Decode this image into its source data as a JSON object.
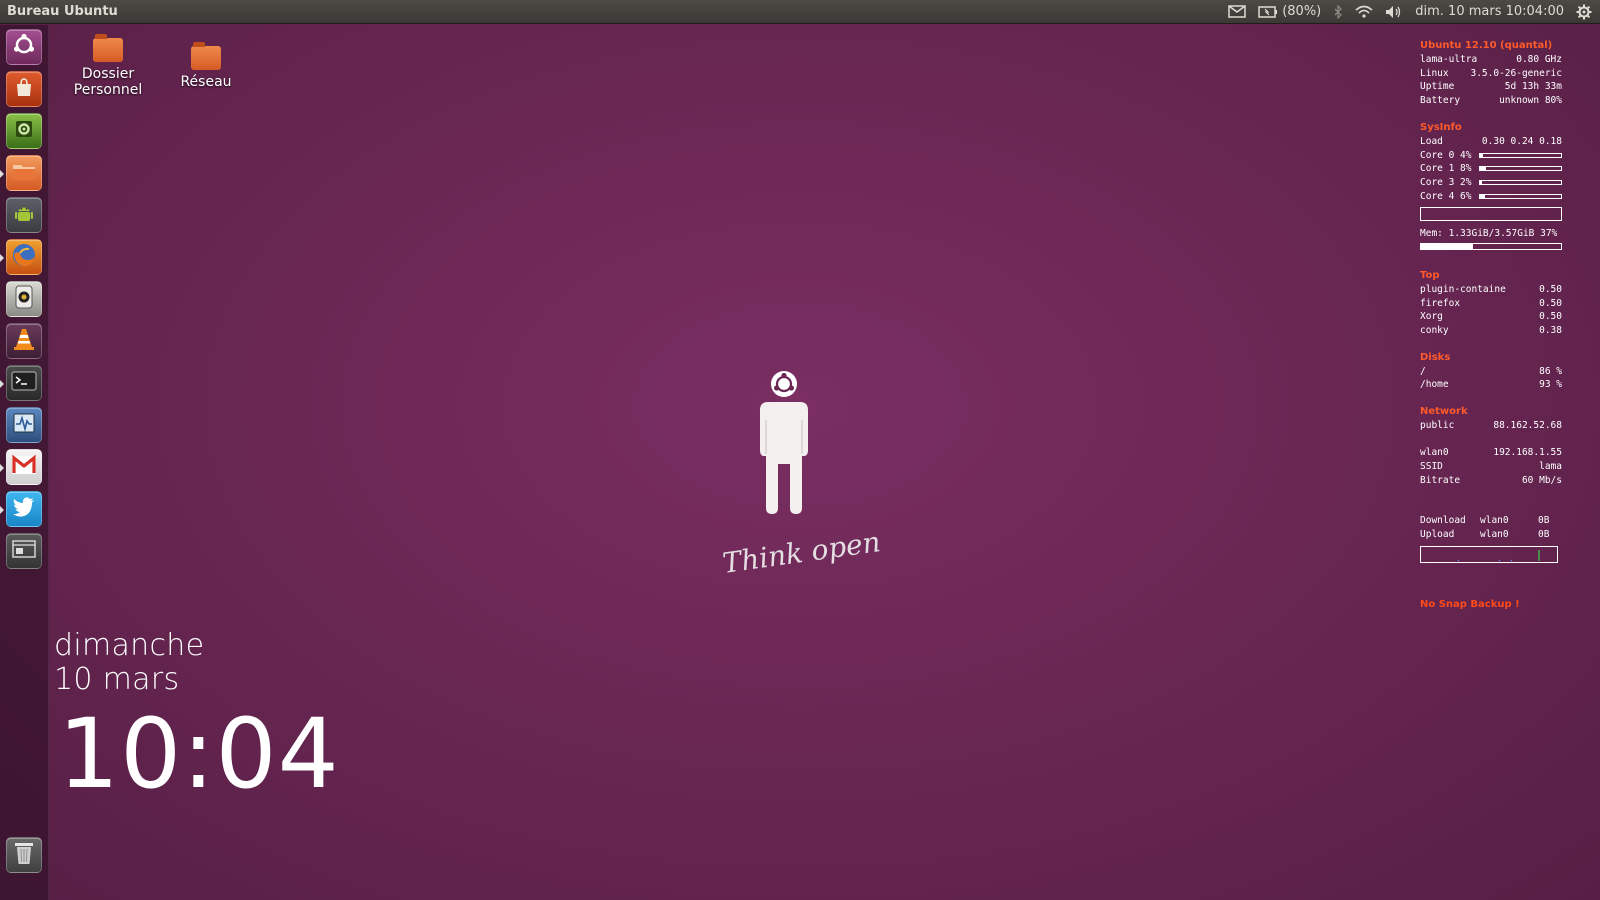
{
  "top_panel": {
    "title": "Bureau Ubuntu",
    "battery_text": "(80%)",
    "datetime": "dim. 10 mars  10:04:00",
    "icons": [
      "mail-icon",
      "battery-icon",
      "bluetooth-icon",
      "wifi-icon",
      "volume-icon",
      "gear-icon"
    ]
  },
  "launcher": {
    "items": [
      {
        "name": "dash-home",
        "icon": "ubuntu-logo-icon",
        "running": false
      },
      {
        "name": "software-center",
        "icon": "shopping-bag-icon",
        "running": false
      },
      {
        "name": "system-settings",
        "icon": "settings-icon",
        "running": false
      },
      {
        "name": "files",
        "icon": "folder-icon",
        "running": true
      },
      {
        "name": "android-sdk",
        "icon": "android-icon",
        "running": false
      },
      {
        "name": "firefox",
        "icon": "firefox-icon",
        "running": true
      },
      {
        "name": "rhythmbox",
        "icon": "speaker-icon",
        "running": false
      },
      {
        "name": "vlc",
        "icon": "vlc-cone-icon",
        "running": false
      },
      {
        "name": "terminal",
        "icon": "terminal-icon",
        "running": true
      },
      {
        "name": "system-monitor",
        "icon": "monitor-icon",
        "running": false
      },
      {
        "name": "gmail",
        "icon": "gmail-icon",
        "running": true
      },
      {
        "name": "twitter",
        "icon": "twitter-icon",
        "running": true
      },
      {
        "name": "workspace-switcher",
        "icon": "workspace-icon",
        "running": false
      },
      {
        "name": "trash",
        "icon": "trash-icon",
        "running": false
      }
    ]
  },
  "desktop": {
    "icons": [
      {
        "label_line1": "Dossier",
        "label_line2": "Personnel"
      },
      {
        "label_line1": "Réseau",
        "label_line2": ""
      }
    ],
    "tagline": "Think open"
  },
  "clock_widget": {
    "day": "dimanche",
    "date": "10 mars",
    "time": "10:04"
  },
  "conky": {
    "sys_title": "Ubuntu 12.10 (quantal)",
    "sys_rows": [
      {
        "k": "lama-ultra",
        "v": "0.80 GHz"
      },
      {
        "k": "Linux",
        "v": "3.5.0-26-generic"
      },
      {
        "k": "Uptime",
        "v": "5d 13h 33m"
      },
      {
        "k": "Battery",
        "v": "unknown 80%"
      }
    ],
    "sysinfo_title": "SysInfo",
    "load_label": "Load",
    "load_value": "0.30 0.24 0.18",
    "cores": [
      {
        "label": "Core 0 4%",
        "fraction": 0.04
      },
      {
        "label": "Core 1 8%",
        "fraction": 0.08
      },
      {
        "label": "Core 3 2%",
        "fraction": 0.02
      },
      {
        "label": "Core 4 6%",
        "fraction": 0.06
      }
    ],
    "mem_text": "Mem: 1.33GiB/3.57GiB 37%",
    "mem_fraction": 0.37,
    "top_title": "Top",
    "top_rows": [
      {
        "k": "plugin-containe",
        "v": "0.50"
      },
      {
        "k": "firefox",
        "v": "0.50"
      },
      {
        "k": "Xorg",
        "v": "0.50"
      },
      {
        "k": "conky",
        "v": "0.38"
      }
    ],
    "disks_title": "Disks",
    "disk_rows": [
      {
        "k": "/",
        "v": "86 %"
      },
      {
        "k": "/home",
        "v": "93 %"
      }
    ],
    "network_title": "Network",
    "net_rows_a": [
      {
        "k": "public",
        "v": "88.162.52.68"
      }
    ],
    "net_rows_b": [
      {
        "k": "wlan0",
        "v": "192.168.1.55"
      },
      {
        "k": "SSID",
        "v": "lama"
      },
      {
        "k": "Bitrate",
        "v": "60 Mb/s"
      }
    ],
    "traffic_rows": [
      {
        "k": "Download",
        "iface": "wlan0",
        "v": "0B"
      },
      {
        "k": "Upload",
        "iface": "wlan0",
        "v": "0B"
      }
    ],
    "warning": "No Snap Backup !"
  },
  "colors": {
    "accent": "#ff5a2a",
    "background": "#6a2754",
    "panel": "#3c3b37"
  }
}
